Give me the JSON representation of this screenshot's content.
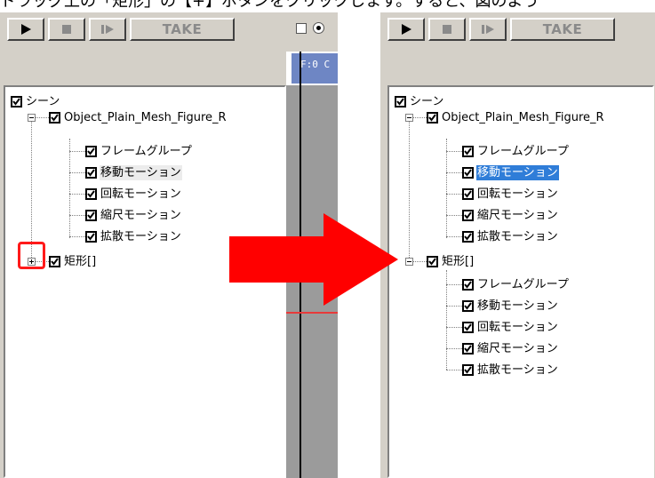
{
  "caption": "ドラッグ上の「矩形」の【+】ボタンをクリックします。すると、図のよう",
  "toolbar": {
    "play_icon": "play-icon",
    "stop_icon": "stop-icon",
    "step_icon": "step-forward-icon",
    "take_label": "TAKE"
  },
  "timeline": {
    "frame_label": "F:0 C"
  },
  "left_tree": {
    "root_label": "シーン",
    "object_label": "Object_Plain_Mesh_Figure_R",
    "motions": [
      "フレームグループ",
      "移動モーション",
      "回転モーション",
      "縮尺モーション",
      "拡散モーション"
    ],
    "rect_label": "矩形[]"
  },
  "right_tree": {
    "root_label": "シーン",
    "object_label": "Object_Plain_Mesh_Figure_R",
    "motions": [
      "フレームグループ",
      "移動モーション",
      "回転モーション",
      "縮尺モーション",
      "拡散モーション"
    ],
    "rect_label": "矩形[]",
    "rect_motions": [
      "フレームグループ",
      "移動モーション",
      "回転モーション",
      "縮尺モーション",
      "拡散モーション"
    ]
  },
  "colors": {
    "arrow": "#ff0000",
    "highlight": "#ff1a1a",
    "selection": "#2f7dd8"
  }
}
